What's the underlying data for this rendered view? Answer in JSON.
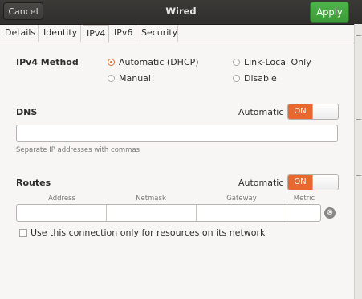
{
  "header": {
    "cancel_label": "Cancel",
    "title": "Wired",
    "apply_label": "Apply"
  },
  "tabs": [
    {
      "label": "Details"
    },
    {
      "label": "Identity"
    },
    {
      "label": "IPv4",
      "active": true
    },
    {
      "label": "IPv6"
    },
    {
      "label": "Security"
    }
  ],
  "ipv4": {
    "method_label": "IPv4 Method",
    "options": [
      {
        "label": "Automatic (DHCP)",
        "selected": true
      },
      {
        "label": "Link-Local Only",
        "selected": false
      },
      {
        "label": "Manual",
        "selected": false
      },
      {
        "label": "Disable",
        "selected": false
      }
    ]
  },
  "dns": {
    "label": "DNS",
    "automatic_label": "Automatic",
    "switch_label": "ON",
    "value": "",
    "hint": "Separate IP addresses with commas"
  },
  "routes": {
    "label": "Routes",
    "automatic_label": "Automatic",
    "switch_label": "ON",
    "columns": [
      "Address",
      "Netmask",
      "Gateway",
      "Metric"
    ],
    "clear_symbol": "⊗"
  },
  "only_resources": {
    "label": "Use this connection only for resources on its network",
    "checked": false
  },
  "colors": {
    "accent_orange": "#e8682f",
    "apply_green": "#45a841",
    "header_dark": "#33322f"
  }
}
